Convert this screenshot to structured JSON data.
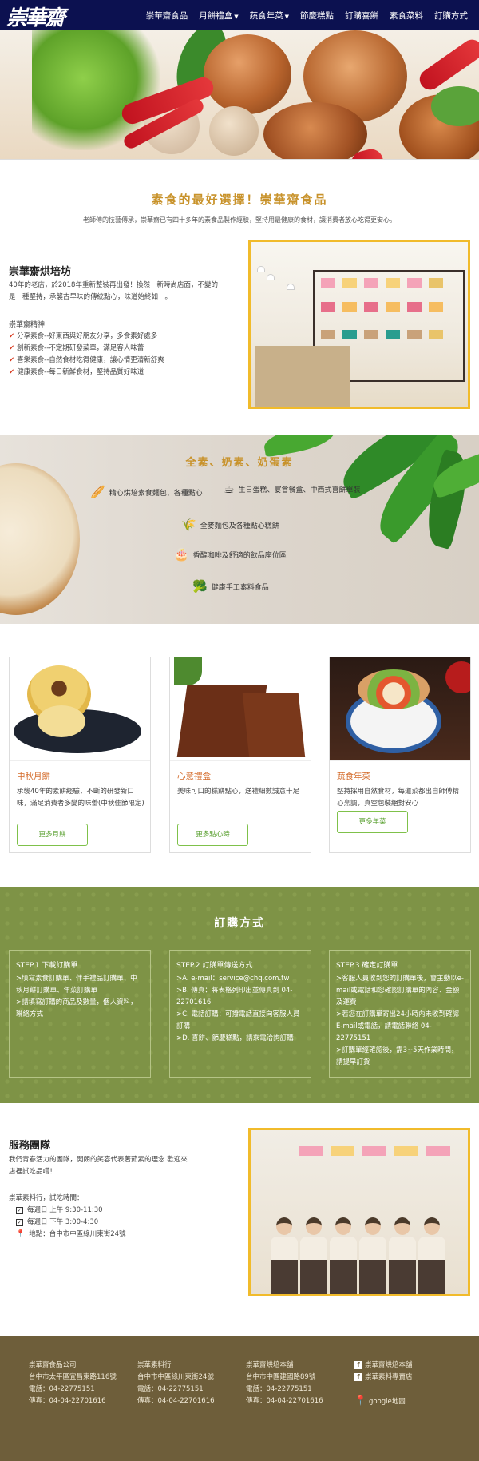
{
  "nav": {
    "logo": "崇華齋",
    "items": [
      {
        "label": "崇華齋食品",
        "caret": false
      },
      {
        "label": "月餅禮盒",
        "caret": true
      },
      {
        "label": "蔬食年菜",
        "caret": true
      },
      {
        "label": "節慶糕點",
        "caret": false
      },
      {
        "label": "訂購喜餅",
        "caret": false
      },
      {
        "label": "素食菜料",
        "caret": false
      },
      {
        "label": "訂購方式",
        "caret": false
      }
    ]
  },
  "intro": {
    "title": "素食的最好選擇！崇華齋食品",
    "text": "老師傅的技藝傳承，崇華齋已有四十多年的素食品製作經驗，堅持用最健康的食材，讓消費者放心吃得更安心。"
  },
  "bakery": {
    "title": "崇華齋烘培坊",
    "desc": "40年的老店，於2018年重新整裝再出發！換然一新時尚店面，不變的是一種堅持，承襲古早味的傳統點心，味道始終如一。",
    "spirit_title": "崇華齋精神",
    "spirit": [
      "分享素食--好東西與好朋友分享，多食素好處多",
      "創新素食--不定期研發菜單，滿足客人味蕾",
      "喜樂素食--自然食材吃得健康，讓心情更清新舒爽",
      "健康素食--每日新鮮食材，堅持品質好味道"
    ]
  },
  "features": {
    "title": "全素、奶素、奶蛋素",
    "items": [
      "精心烘培素食麵包、各種點心",
      "生日蛋糕、宴會餐盒、中西式喜餅單裝",
      "全麥麵包及各種點心糕餅",
      "香醇咖啡及舒適的飲品座位區",
      "健康手工素料食品"
    ],
    "icons": [
      "bread-icon",
      "coffee-icon",
      "wheat-icon",
      "cake-icon",
      "broccoli-icon"
    ]
  },
  "products": [
    {
      "title": "中秋月餅",
      "text": "承襲40年的素餅經驗，不斷的研發新口味，滿足消費者多變的味蕾(中秋佳節限定)",
      "button": "更多月餅"
    },
    {
      "title": "心意禮盒",
      "text": "美味可口的糕餅點心，送禮細數誠意十足",
      "button": "更多點心時"
    },
    {
      "title": "蔬食年菜",
      "text": "堅持採用自然食材，每道菜都出自師傅精心烹調，真空包裝絕對安心",
      "button": "更多年菜"
    }
  ],
  "order": {
    "title": "訂購方式",
    "steps": [
      {
        "title": "STEP.1 下載訂購單",
        "lines": [
          ">填寫素食訂購單、伴手禮品訂購單、中秋月餅訂購單、年菜訂購單",
          ">請填寫訂購的商品及數量，個人資料，聯絡方式"
        ]
      },
      {
        "title": "STEP.2 訂購單傳送方式",
        "lines": [
          ">A. e-mail：service@chq.com.tw",
          ">B. 傳真：將表格列印出並傳真到 04-22701616",
          ">C. 電話訂購：可撥電話直接向客服人員訂購",
          ">D. 喜餅、節慶糕點，請來電洽詢訂購"
        ]
      },
      {
        "title": "STEP.3 確定訂購單",
        "lines": [
          ">客服人員收到您的訂購單後，會主動以e-mail或電話和您確認訂購單的內容、金額及運費",
          ">若您在訂購單寄出24小時內未收到確認E-mail或電話，請電話聯絡 04-22775151",
          ">訂購單經確認後，需3~5天作業時間，請提早訂貨"
        ]
      }
    ]
  },
  "team": {
    "title": "服務團隊",
    "desc": "我們青春活力的團隊，開朗的笑容代表著茹素的理念 歡迎來店裡試吃品嚐！",
    "hours_label": "崇華素料行，試吃時間：",
    "hours": [
      "每週日 上午 9:30-11:30",
      "每週日 下午 3:00-4:30"
    ],
    "address": "地點：台中市中區綠川東街24號"
  },
  "footer": {
    "cols": [
      {
        "name": "崇華齋食品公司",
        "addr": "台中市太平區宜昌東路116號",
        "tel": "電話：04-22775151",
        "fax": "傳真：04-04-22701616"
      },
      {
        "name": "崇華素料行",
        "addr": "台中市中區綠川東街24號",
        "tel": "電話：04-22775151",
        "fax": "傳真：04-04-22701616"
      },
      {
        "name": "崇華齋烘培本舖",
        "addr": "台中市中區建國路89號",
        "tel": "電話：04-22775151",
        "fax": "傳真：04-04-22701616"
      }
    ],
    "links": {
      "fb1": "崇華齋烘焙本舖",
      "fb2": "崇華素料專賣店",
      "map": "google地圖"
    }
  },
  "colors": {
    "nav": "#0c1150",
    "accent": "#c8922a",
    "order_bg": "#7e9346",
    "footer_bg": "#6e5e3a",
    "photo_border": "#f1bb2b"
  }
}
